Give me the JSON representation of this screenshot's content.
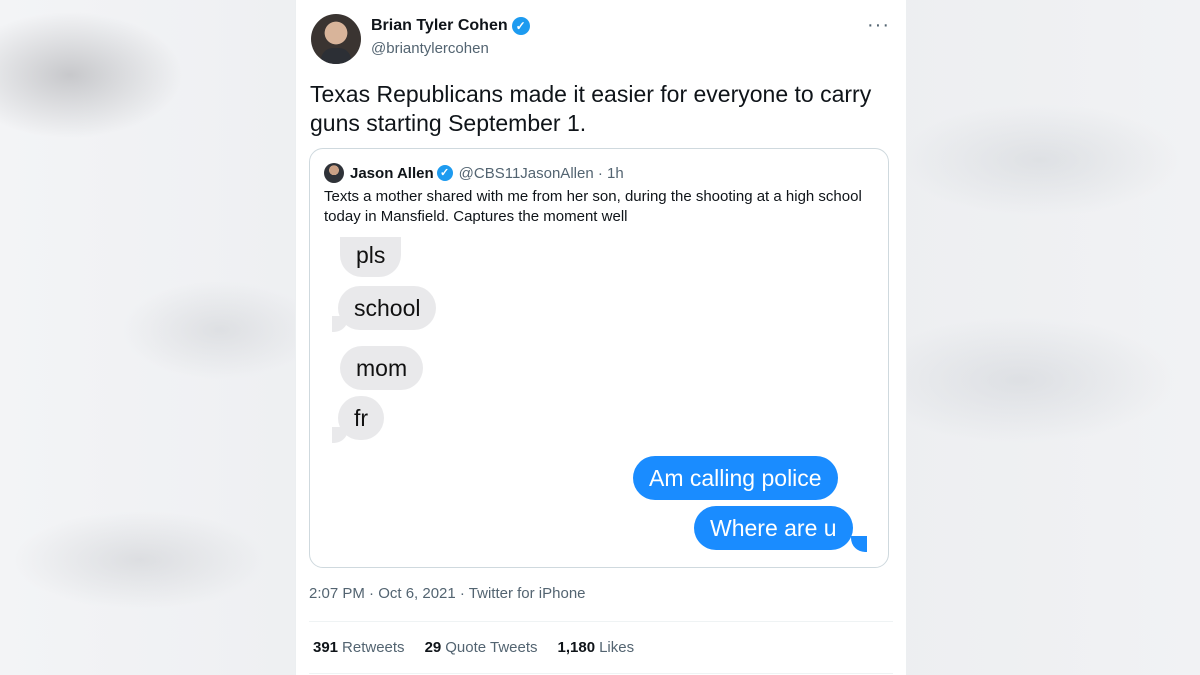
{
  "author": {
    "name": "Brian Tyler Cohen",
    "handle": "@briantylercohen",
    "verified_mark": "✓"
  },
  "more_icon": "···",
  "tweet_text": "Texas Republicans made it easier for everyone to carry guns starting September 1.",
  "quoted": {
    "name": "Jason Allen",
    "verified_mark": "✓",
    "meta": "@CBS11JasonAllen · 1h",
    "text": "Texts a mother shared with me from her son, during the shooting at a high school today in Mansfield. Captures the moment well",
    "messages": [
      {
        "from": "son",
        "text": "pls"
      },
      {
        "from": "son",
        "text": "school"
      },
      {
        "from": "son",
        "text": "mom"
      },
      {
        "from": "son",
        "text": "fr"
      },
      {
        "from": "mom",
        "text": "Am calling police"
      },
      {
        "from": "mom",
        "text": "Where are u"
      }
    ]
  },
  "timestamp": "2:07 PM · Oct 6, 2021 · Twitter for iPhone",
  "stats": [
    {
      "count": "391",
      "label": "Retweets"
    },
    {
      "count": "29",
      "label": "Quote Tweets"
    },
    {
      "count": "1,180",
      "label": "Likes"
    }
  ],
  "colors": {
    "accent": "#1d9bf0",
    "imessage_blue": "#1a8cff",
    "imessage_gray": "#e9e9eb"
  }
}
